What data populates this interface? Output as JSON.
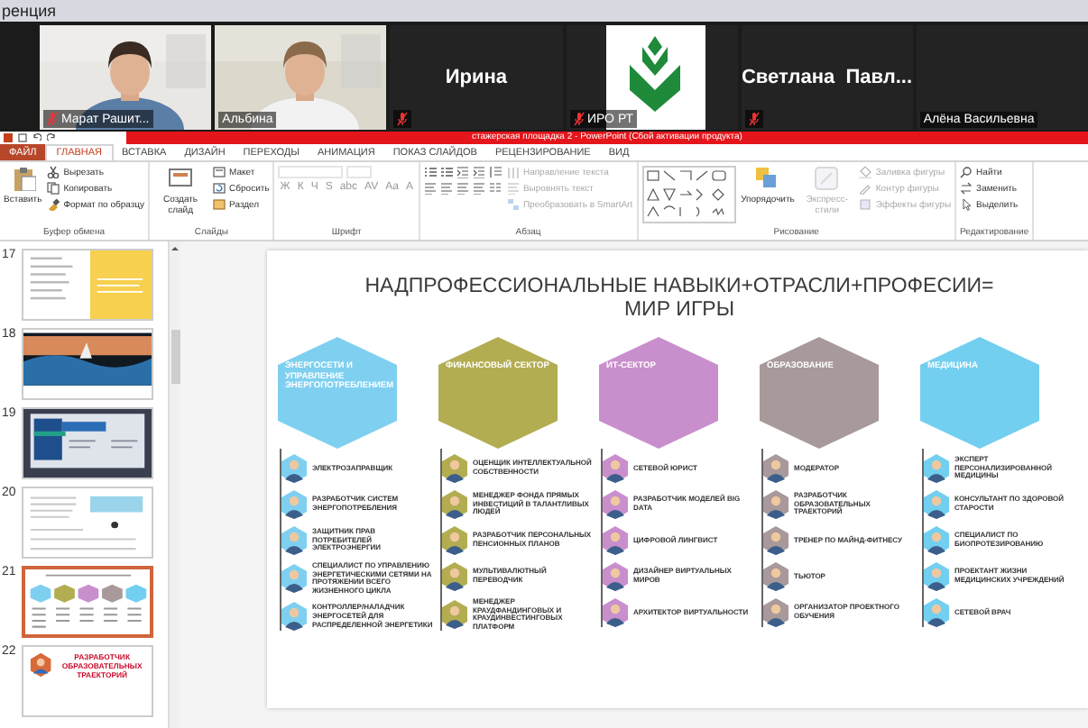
{
  "window": {
    "title": "ренция"
  },
  "participants": [
    {
      "kind": "video",
      "label": "Марат Рашит...",
      "muted": true
    },
    {
      "kind": "video",
      "label": "Альбина",
      "muted": false
    },
    {
      "kind": "name",
      "name": "Ирина",
      "muted": true
    },
    {
      "kind": "logo",
      "label": "ИРО РТ",
      "muted": true
    },
    {
      "kind": "name",
      "name": "Светлана  Павл...",
      "muted": true
    },
    {
      "kind": "name",
      "label": "Алёна Васильевна",
      "muted": false
    }
  ],
  "app": {
    "title": "стажерская площадка 2 - PowerPoint (Сбой активации продукта)",
    "tabs": [
      {
        "label": "ФАЙЛ",
        "kind": "file",
        "selected": false
      },
      {
        "label": "ГЛАВНАЯ",
        "kind": "tab",
        "selected": true
      },
      {
        "label": "ВСТАВКА",
        "kind": "tab",
        "selected": false
      },
      {
        "label": "ДИЗАЙН",
        "kind": "tab",
        "selected": false
      },
      {
        "label": "ПЕРЕХОДЫ",
        "kind": "tab",
        "selected": false
      },
      {
        "label": "АНИМАЦИЯ",
        "kind": "tab",
        "selected": false
      },
      {
        "label": "ПОКАЗ СЛАЙДОВ",
        "kind": "tab",
        "selected": false
      },
      {
        "label": "РЕЦЕНЗИРОВАНИЕ",
        "kind": "tab",
        "selected": false
      },
      {
        "label": "ВИД",
        "kind": "tab",
        "selected": false
      }
    ],
    "ribbon": [
      {
        "label": "Буфер обмена",
        "columns": [
          [
            {
              "kind": "large",
              "label": "Вставить",
              "disabled": false
            }
          ],
          [
            {
              "kind": "small",
              "label": "Вырезать",
              "disabled": false
            },
            {
              "kind": "small",
              "label": "Копировать",
              "disabled": false
            },
            {
              "kind": "small",
              "label": "Формат по образцу",
              "disabled": false
            }
          ]
        ]
      },
      {
        "label": "Слайды",
        "columns": [
          [
            {
              "kind": "large",
              "label": "Создать слайд",
              "disabled": false
            }
          ],
          [
            {
              "kind": "small",
              "label": "Макет",
              "disabled": false
            },
            {
              "kind": "small",
              "label": "Сбросить",
              "disabled": false
            },
            {
              "kind": "small",
              "label": "Раздел",
              "disabled": false
            }
          ]
        ]
      },
      {
        "label": "Шрифт",
        "columns": [
          [
            {
              "kind": "fields",
              "disabled": true
            },
            {
              "kind": "glyphs",
              "glyphs": [
                "Ж",
                "К",
                "Ч",
                "S",
                "abc",
                "AV",
                "Aa",
                "A"
              ],
              "disabled": true
            }
          ]
        ]
      },
      {
        "label": "Абзац",
        "columns": [
          [
            {
              "kind": "list-tools",
              "disabled": false
            },
            {
              "kind": "align-tools",
              "disabled": false
            }
          ],
          [
            {
              "kind": "small",
              "label": "Направление текста",
              "disabled": true
            },
            {
              "kind": "small",
              "label": "Выровнять текст",
              "disabled": true
            },
            {
              "kind": "small",
              "label": "Преобразовать в SmartArt",
              "disabled": true
            }
          ]
        ]
      },
      {
        "label": "Рисование",
        "columns": [
          [
            {
              "kind": "gallery",
              "disabled": false
            }
          ],
          [
            {
              "kind": "large",
              "label": "Упорядочить",
              "disabled": false
            }
          ],
          [
            {
              "kind": "large",
              "label": "Экспресс-стили",
              "disabled": true
            }
          ],
          [
            {
              "kind": "small",
              "label": "Заливка фигуры",
              "disabled": true
            },
            {
              "kind": "small",
              "label": "Контур фигуры",
              "disabled": true
            },
            {
              "kind": "small",
              "label": "Эффекты фигуры",
              "disabled": true
            }
          ]
        ]
      },
      {
        "label": "Редактирование",
        "columns": [
          [
            {
              "kind": "small",
              "label": "Найти",
              "disabled": false
            },
            {
              "kind": "small",
              "label": "Заменить",
              "disabled": false
            },
            {
              "kind": "small",
              "label": "Выделить",
              "disabled": false
            }
          ]
        ]
      }
    ],
    "thumbnails": [
      {
        "number": "17",
        "kind": "yellow",
        "selected": false
      },
      {
        "number": "18",
        "selected": false
      },
      {
        "number": "19",
        "kind": "blue",
        "selected": false
      },
      {
        "number": "20",
        "kind": "doc",
        "selected": false
      },
      {
        "number": "21",
        "kind": "hexes",
        "selected": true
      },
      {
        "number": "22",
        "kind": "title",
        "text": "РАЗРАБОТЧИК ОБРАЗОВАТЕЛЬНЫХ ТРАЕКТОРИЙ",
        "selected": false
      }
    ],
    "slide": {
      "title": [
        "НАДПРОФЕССИОНАЛЬНЫЕ НАВЫКИ+ОТРАСЛИ+ПРОФЕСИИ=",
        "МИР ИГРЫ"
      ],
      "columns": [
        {
          "title": "ЭНЕРГОСЕТИ И УПРАВЛЕНИЕ ЭНЕРГОПОТРЕБЛЕНИЕМ",
          "color": "#7fd0f0",
          "items": [
            "ЭЛЕКТРОЗАПРАВЩИК",
            "РАЗРАБОТЧИК СИСТЕМ ЭНЕРГОПОТРЕБЛЕНИЯ",
            "ЗАЩИТНИК ПРАВ ПОТРЕБИТЕЛЕЙ ЭЛЕКТРОЭНЕРГИИ",
            "СПЕЦИАЛИСТ ПО УПРАВЛЕНИЮ ЭНЕРГЕТИЧЕСКИМИ СЕТЯМИ НА ПРОТЯЖЕНИИ ВСЕГО ЖИЗНЕННОГО ЦИКЛА",
            "КОНТРОЛЛЕР/НАЛАДЧИК ЭНЕРГОСЕТЕЙ ДЛЯ РАСПРЕДЕЛЕННОЙ ЭНЕРГЕТИКИ"
          ]
        },
        {
          "title": "ФИНАНСОВЫЙ СЕКТОР",
          "color": "#b3ad52",
          "items": [
            "ОЦЕНЩИК ИНТЕЛЛЕКТУАЛЬНОЙ СОБСТВЕННОСТИ",
            "МЕНЕДЖЕР ФОНДА ПРЯМЫХ ИНВЕСТИЦИЙ В ТАЛАНТЛИВЫХ ЛЮДЕЙ",
            "РАЗРАБОТЧИК ПЕРСОНАЛЬНЫХ ПЕНСИОННЫХ ПЛАНОВ",
            "МУЛЬТИВАЛЮТНЫЙ ПЕРЕВОДЧИК",
            "МЕНЕДЖЕР КРАУДФАНДИНГОВЫХ И КРАУДИНВЕСТИНГОВЫХ ПЛАТФОРМ"
          ]
        },
        {
          "title": "ИТ-СЕКТОР",
          "color": "#c98fcd",
          "items": [
            "СЕТЕВОЙ ЮРИСТ",
            "РАЗРАБОТЧИК МОДЕЛЕЙ BIG DATA",
            "ЦИФРОВОЙ ЛИНГВИСТ",
            "ДИЗАЙНЕР ВИРТУАЛЬНЫХ МИРОВ",
            "АРХИТЕКТОР ВИРТУАЛЬНОСТИ"
          ]
        },
        {
          "title": "ОБРАЗОВАНИЕ",
          "color": "#a8999a",
          "items": [
            "МОДЕРАТОР",
            "РАЗРАБОТЧИК ОБРАЗОВАТЕЛЬНЫХ ТРАЕКТОРИЙ",
            "ТРЕНЕР ПО МАЙНД-ФИТНЕСУ",
            "ТЬЮТОР",
            "ОРГАНИЗАТОР ПРОЕКТНОГО ОБУЧЕНИЯ"
          ]
        },
        {
          "title": "МЕДИЦИНА",
          "color": "#72cff0",
          "items": [
            "ЭКСПЕРТ ПЕРСОНАЛИЗИРОВАННОЙ МЕДИЦИНЫ",
            "КОНСУЛЬТАНТ ПО ЗДОРОВОЙ СТАРОСТИ",
            "СПЕЦИАЛИСТ ПО БИОПРОТЕЗИРОВАНИЮ",
            "ПРОЕКТАНТ ЖИЗНИ МЕДИЦИНСКИХ УЧРЕЖДЕНИЙ",
            "СЕТЕВОЙ ВРАЧ"
          ]
        }
      ]
    }
  }
}
